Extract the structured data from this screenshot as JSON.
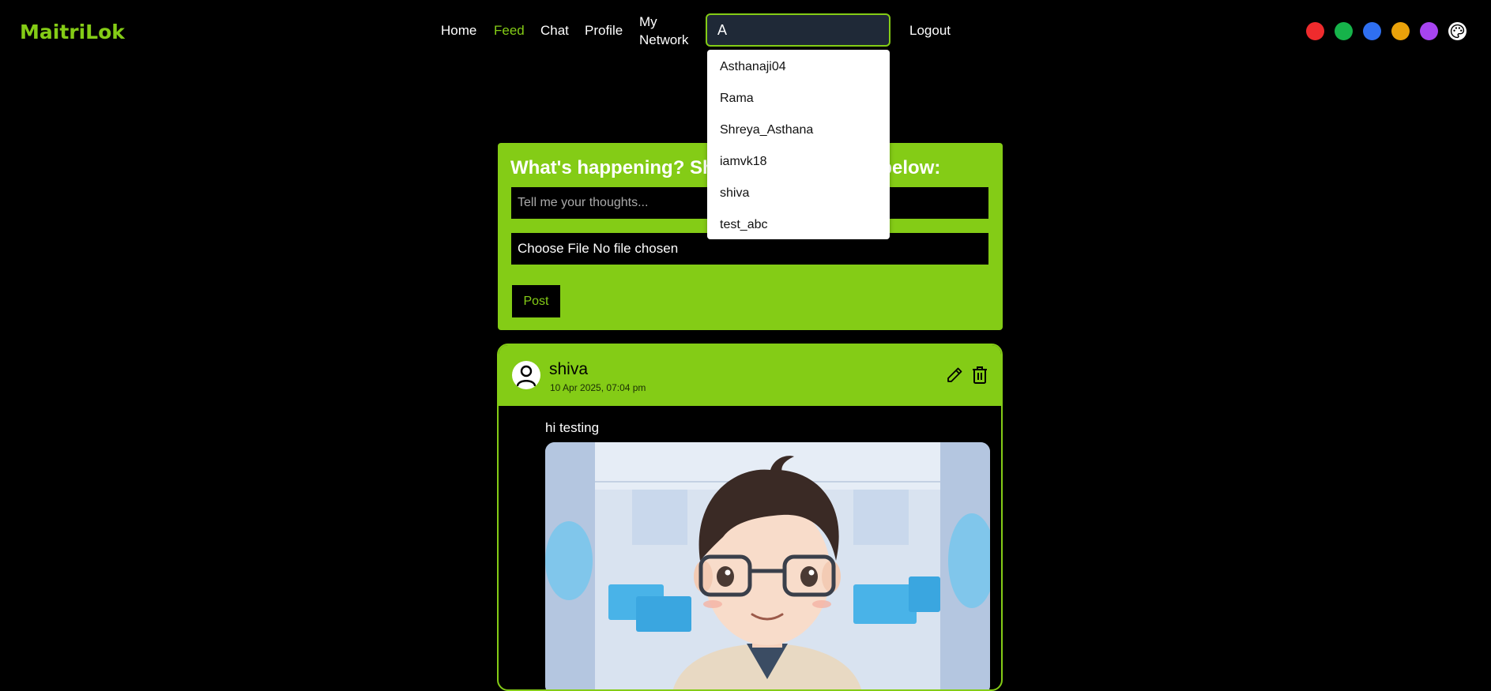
{
  "app": {
    "logo": "MaitriLok"
  },
  "nav": {
    "home": "Home",
    "feed": "Feed",
    "chat": "Chat",
    "profile": "Profile",
    "network_line1": "My",
    "network_line2": "Network",
    "logout": "Logout"
  },
  "search": {
    "value": "A",
    "results": [
      "Asthanaji04",
      "Rama",
      "Shreya_Asthana",
      "iamvk18",
      "shiva",
      "test_abc"
    ]
  },
  "theme": {
    "colors": [
      "#ef2b2d",
      "#16b34a",
      "#2f6ff0",
      "#eaa20a",
      "#a744f0"
    ],
    "palette_icon": "palette-icon"
  },
  "composer": {
    "title": "What's happening? Share your thoughts below:",
    "placeholder": "Tell me your thoughts...",
    "file_label": "Choose File No file chosen",
    "post_label": "Post"
  },
  "post": {
    "author": "shiva",
    "timestamp": "10 Apr 2025, 07:04 pm",
    "text": "hi testing",
    "icons": [
      "user-avatar-icon",
      "edit-icon",
      "trash-icon"
    ]
  },
  "accent_color": "#84cc16"
}
